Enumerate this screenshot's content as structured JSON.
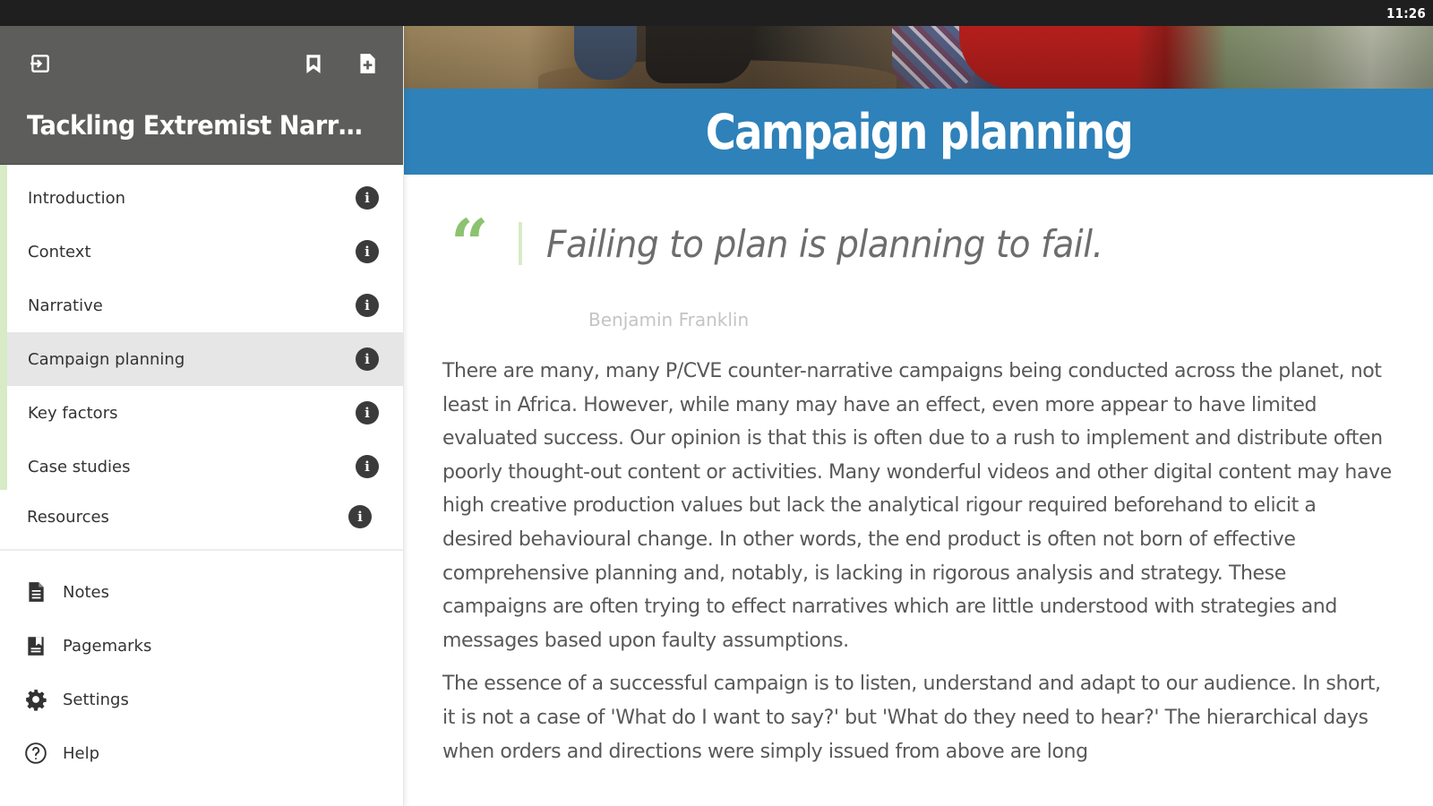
{
  "status_bar": {
    "time": "11:26"
  },
  "sidebar": {
    "book_title": "Tackling Extremist Narrativ...",
    "header_icons": [
      "exit-icon",
      "bookmark-icon",
      "add-page-icon"
    ],
    "chapters": [
      {
        "label": "Introduction",
        "icon": "info-icon",
        "active": false
      },
      {
        "label": "Context",
        "icon": "info-icon",
        "active": false
      },
      {
        "label": "Narrative",
        "icon": "info-icon",
        "active": false
      },
      {
        "label": "Campaign planning",
        "icon": "info-icon",
        "active": true
      },
      {
        "label": "Key factors",
        "icon": "info-icon",
        "active": false
      },
      {
        "label": "Case studies",
        "icon": "info-icon",
        "active": false
      },
      {
        "label": "Resources",
        "icon": "info-icon",
        "active": false
      }
    ],
    "tools": [
      {
        "label": "Notes",
        "icon": "notes-icon"
      },
      {
        "label": "Pagemarks",
        "icon": "pagemarks-icon"
      },
      {
        "label": "Settings",
        "icon": "gear-icon"
      },
      {
        "label": "Help",
        "icon": "help-icon"
      }
    ]
  },
  "main": {
    "page_title": "Campaign planning",
    "quote": {
      "mark": "“",
      "text": "Failing to plan is planning to fail.",
      "author": "Benjamin Franklin"
    },
    "paragraphs": [
      "There are many, many P/CVE counter-narrative campaigns being conducted across the planet, not least in Africa. However, while many may have an effect, even more appear to have limited evaluated success. Our opinion is that this is often due to a rush to implement and distribute often poorly thought-out content or activities. Many wonderful videos and other digital content may have high creative production values but lack the analytical rigour required beforehand to elicit a desired behavioural change. In other words, the end product is often not born of effective comprehensive planning and, notably, is lacking in rigorous analysis and strategy. These campaigns are often trying to effect narratives which are little understood with strategies and messages based upon faulty assumptions.",
      "The essence of a successful campaign is to listen, understand and adapt to our audience. In short, it is not a case of 'What do I want to say?' but 'What do they need to hear?' The hierarchical days when orders and directions were simply issued from above are long"
    ]
  },
  "colors": {
    "status_bar": "#1f1f1f",
    "sidebar_header": "#5d5d5b",
    "title_bar": "#2e81b9",
    "quote_accent": "#8cc270",
    "chapter_rail": "#d6ebc6",
    "active_chapter_bg": "#e6e6e6"
  }
}
